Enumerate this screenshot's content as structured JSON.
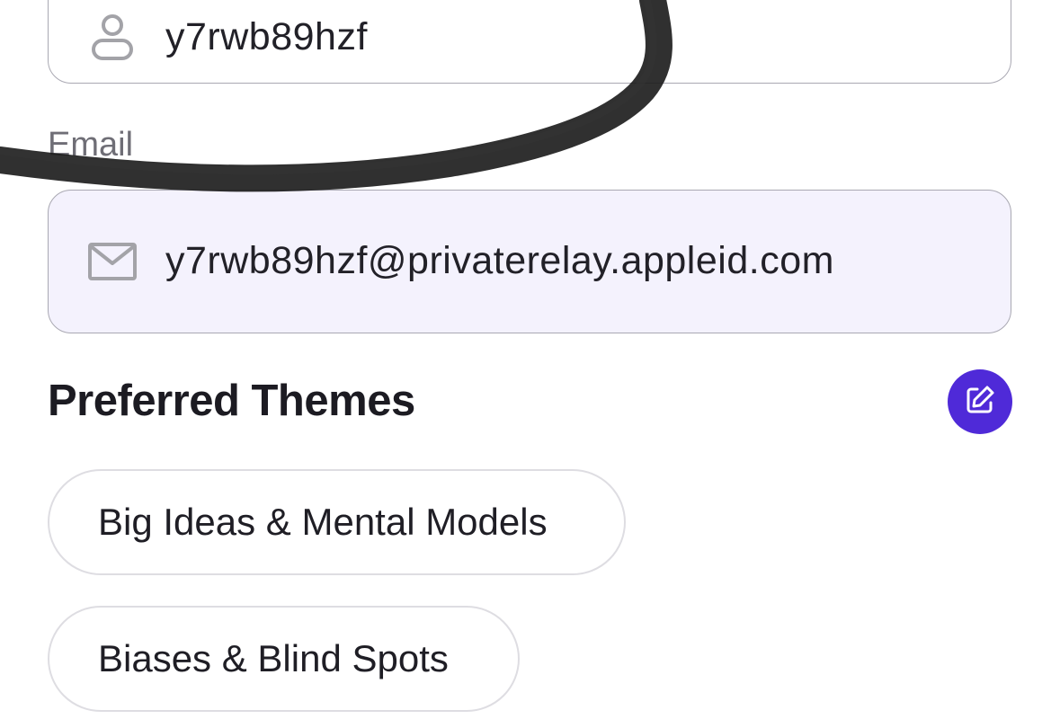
{
  "profile": {
    "username": {
      "icon": "person-icon",
      "value": "y7rwb89hzf"
    },
    "email": {
      "label": "Email",
      "icon": "mail-icon",
      "value": "y7rwb89hzf@privaterelay.appleid.com"
    }
  },
  "themes": {
    "title": "Preferred Themes",
    "edit_icon": "edit-icon",
    "accent_color": "#4f2ad8",
    "items": [
      "Big Ideas & Mental Models",
      "Biases & Blind Spots"
    ]
  },
  "annotation": {
    "icon": "scribble-stroke",
    "color": "#1a1a1a"
  }
}
